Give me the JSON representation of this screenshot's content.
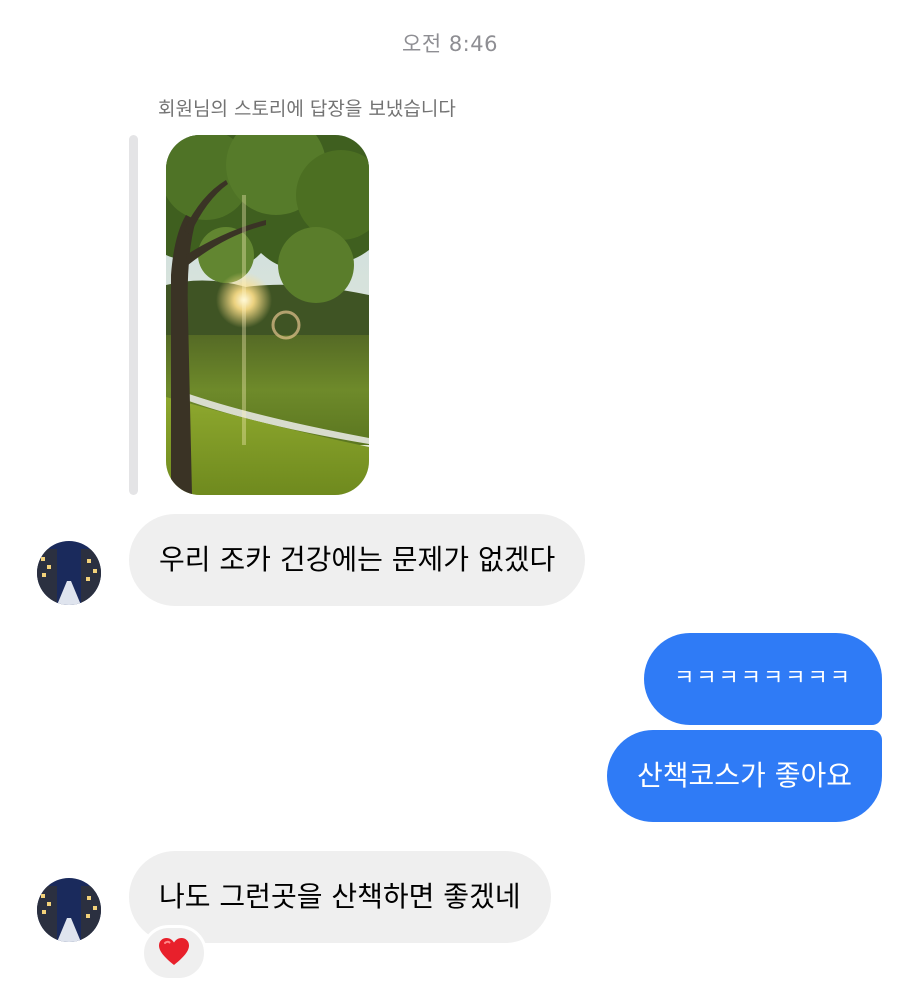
{
  "chat": {
    "timestamp": "오전 8:46",
    "story_reply_caption": "회원님의 스토리에 답장을 보냈습니다",
    "messages": [
      {
        "from": "other",
        "text": "우리 조카 건강에는 문제가 없겠다"
      },
      {
        "from": "me",
        "text": "ㅋㅋㅋㅋㅋㅋㅋㅋ"
      },
      {
        "from": "me",
        "text": "산책코스가 좋아요"
      },
      {
        "from": "other",
        "text": "나도 그런곳을 산책하면 좋겠네",
        "reaction": "heart"
      }
    ]
  },
  "colors": {
    "outgoing_bubble": "#2f7bf6",
    "incoming_bubble": "#efefef",
    "reaction_heart": "#e8202b"
  },
  "icons": {
    "reaction": "heart-icon",
    "avatar": "city-night-photo"
  }
}
